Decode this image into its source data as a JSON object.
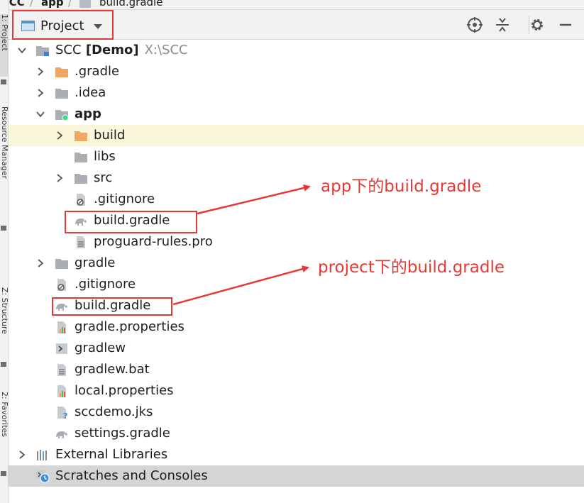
{
  "breadcrumb": {
    "items": [
      "SCC",
      "app",
      "build.gradle"
    ]
  },
  "side_tabs": {
    "project": "1: Project",
    "resource_manager": "Resource Manager",
    "structure": "Z: Structure",
    "favorites": "2: Favorites"
  },
  "toolbar": {
    "view_selector": "Project",
    "icons": [
      "locate-icon",
      "collapse-all-icon",
      "gear-icon",
      "minimize-icon"
    ]
  },
  "tree": [
    {
      "name": "SCC",
      "bold_suffix": "[Demo]",
      "path": "X:\\SCC",
      "icon": "module-folder-icon",
      "expanded": true,
      "level": 0
    },
    {
      "name": ".gradle",
      "icon": "orange-folder-icon",
      "expanded": false,
      "level": 1
    },
    {
      "name": ".idea",
      "icon": "folder-icon",
      "expanded": false,
      "level": 1
    },
    {
      "name": "app",
      "icon": "android-module-icon",
      "expanded": true,
      "level": 1,
      "bold": true
    },
    {
      "name": "build",
      "icon": "orange-folder-icon",
      "expanded": false,
      "level": 2,
      "highlight": "yellow"
    },
    {
      "name": "libs",
      "icon": "folder-icon",
      "level": 2
    },
    {
      "name": "src",
      "icon": "folder-icon",
      "expanded": false,
      "level": 2
    },
    {
      "name": ".gitignore",
      "icon": "ignored-file-icon",
      "level": 2
    },
    {
      "name": "build.gradle",
      "icon": "gradle-elephant-icon",
      "level": 2,
      "boxed": true
    },
    {
      "name": "proguard-rules.pro",
      "icon": "text-file-icon",
      "level": 2
    },
    {
      "name": "gradle",
      "icon": "folder-icon",
      "expanded": false,
      "level": 1
    },
    {
      "name": ".gitignore",
      "icon": "ignored-file-icon",
      "level": 1
    },
    {
      "name": "build.gradle",
      "icon": "gradle-elephant-icon",
      "level": 1,
      "boxed": true
    },
    {
      "name": "gradle.properties",
      "icon": "properties-file-icon",
      "level": 1
    },
    {
      "name": "gradlew",
      "icon": "shell-script-icon",
      "level": 1
    },
    {
      "name": "gradlew.bat",
      "icon": "text-file-icon",
      "level": 1
    },
    {
      "name": "local.properties",
      "icon": "properties-file-icon",
      "level": 1
    },
    {
      "name": "sccdemo.jks",
      "icon": "unknown-file-icon",
      "level": 1
    },
    {
      "name": "settings.gradle",
      "icon": "gradle-elephant-icon",
      "level": 1
    },
    {
      "name": "External Libraries",
      "icon": "libraries-icon",
      "expanded": false,
      "level": 0
    },
    {
      "name": "Scratches and Consoles",
      "icon": "scratches-icon",
      "level": 0,
      "highlight": "gray"
    }
  ],
  "annotations": {
    "app_build_gradle": "app下的build.gradle",
    "project_build_gradle": "project下的build.gradle"
  },
  "colors": {
    "annotation_red": "#e53935",
    "selection_yellow": "#fbf7da",
    "selection_gray": "#d5d5d5",
    "folder_gray": "#a9afb5",
    "folder_orange": "#f0a766",
    "text_gray": "#8a8a8a"
  }
}
